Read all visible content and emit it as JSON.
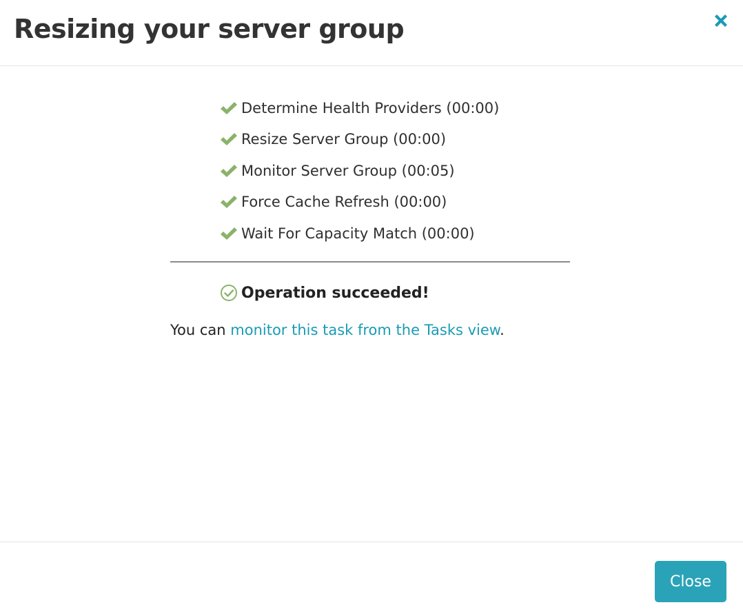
{
  "header": {
    "title": "Resizing your server group",
    "close_icon": "close-icon"
  },
  "tasks": [
    {
      "label": "Determine Health Providers (00:00)",
      "status": "complete"
    },
    {
      "label": "Resize Server Group (00:00)",
      "status": "complete"
    },
    {
      "label": "Monitor Server Group (00:05)",
      "status": "complete"
    },
    {
      "label": "Force Cache Refresh (00:00)",
      "status": "complete"
    },
    {
      "label": "Wait For Capacity Match (00:00)",
      "status": "complete"
    }
  ],
  "result": {
    "icon": "check-circle-icon",
    "text": "Operation succeeded!"
  },
  "monitor": {
    "prefix": "You can ",
    "link_text": "monitor this task from the Tasks view",
    "suffix": "."
  },
  "footer": {
    "close_label": "Close"
  },
  "colors": {
    "check_green": "#8bb26a",
    "accent_teal": "#1a9bb5",
    "button_bg": "#2aa3b8"
  }
}
